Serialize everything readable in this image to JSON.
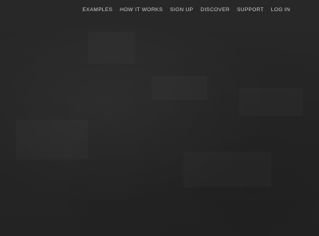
{
  "nav": {
    "items": [
      {
        "label": "EXAMPLES"
      },
      {
        "label": "HOW IT WORKS"
      },
      {
        "label": "SIGN UP"
      },
      {
        "label": "DISCOVER"
      },
      {
        "label": "SUPPORT"
      },
      {
        "label": "LOG IN"
      }
    ]
  },
  "colors": {
    "background": "#262626",
    "nav_text": "#cfcfcf"
  }
}
